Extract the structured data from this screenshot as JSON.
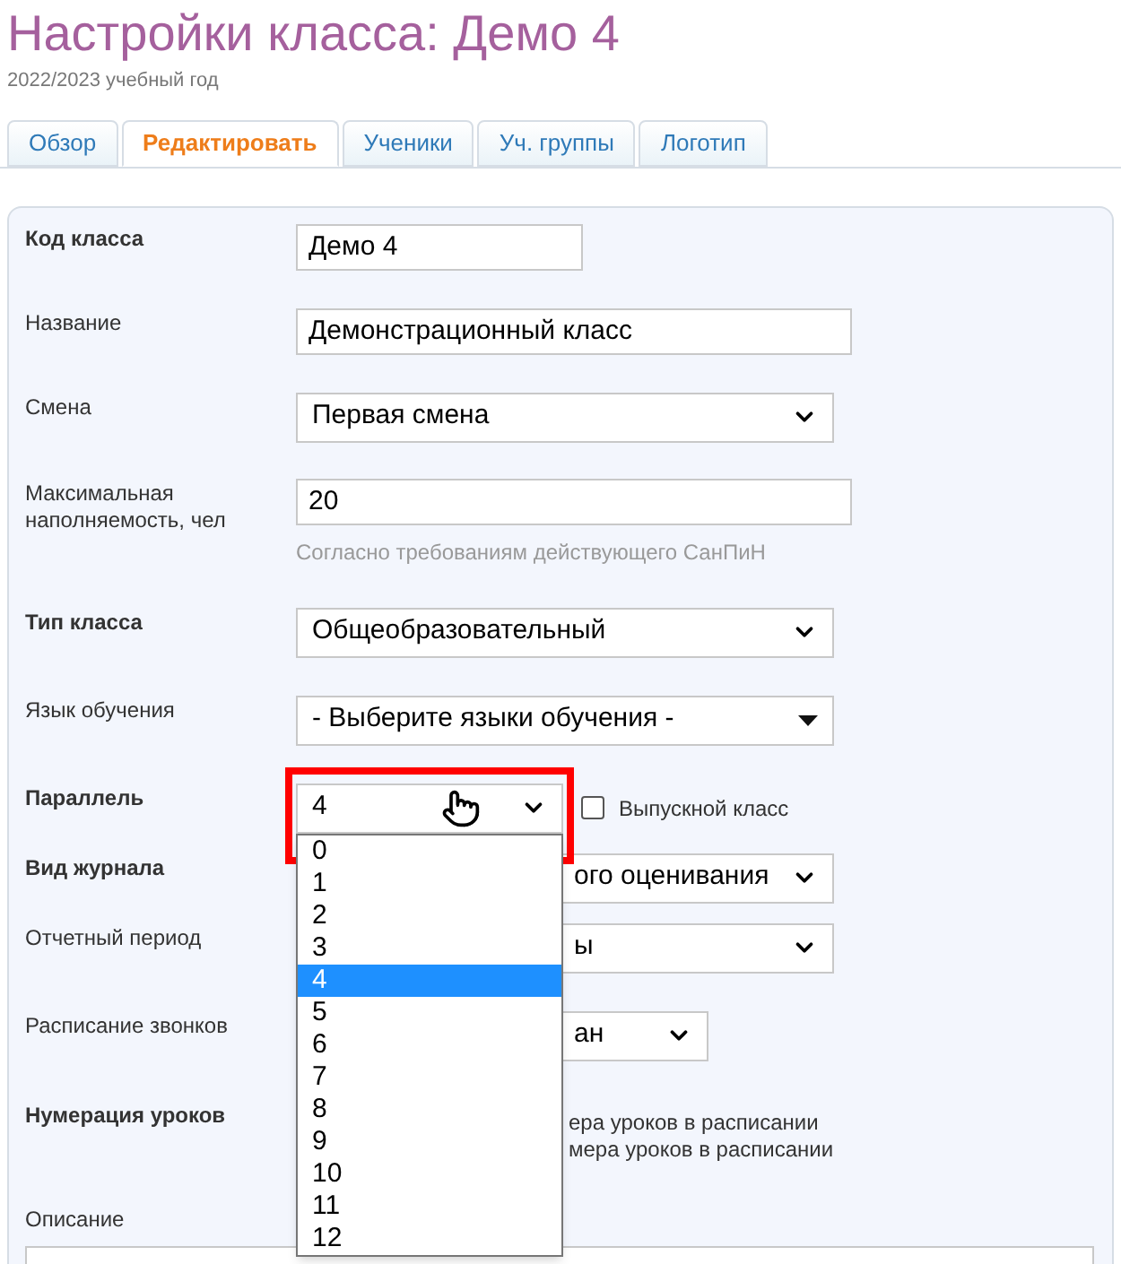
{
  "page": {
    "title": "Настройки класса: Демо 4",
    "subtitle": "2022/2023 учебный год"
  },
  "tabs": [
    {
      "label": "Обзор",
      "selected": false
    },
    {
      "label": "Редактировать",
      "selected": true
    },
    {
      "label": "Ученики",
      "selected": false
    },
    {
      "label": "Уч. группы",
      "selected": false
    },
    {
      "label": "Логотип",
      "selected": false
    }
  ],
  "form": [
    {
      "label": "Код класса",
      "bold": true,
      "kind": "text",
      "value": "Демо 4"
    },
    {
      "label": "Название",
      "bold": false,
      "kind": "text",
      "value": "Демонстрационный класс"
    },
    {
      "label": "Смена",
      "bold": false,
      "kind": "select",
      "value": "Первая смена"
    },
    {
      "label": "Максимальная наполняемость, чел",
      "bold": false,
      "kind": "text",
      "value": "20",
      "hint": "Согласно требованиям действующего СанПиН"
    },
    {
      "label": "Тип класса",
      "bold": true,
      "kind": "select",
      "value": "Общеобразовательный"
    },
    {
      "label": "Язык обучения",
      "bold": false,
      "kind": "multiselect",
      "value": "- Выберите языки обучения -"
    },
    {
      "label": "Параллель",
      "bold": true,
      "kind": "dropdown",
      "value": "4",
      "open": true,
      "highlighted": true,
      "checkbox": {
        "label": "Выпускной класс",
        "checked": false
      },
      "options": [
        {
          "label": "0",
          "selected": false
        },
        {
          "label": "1",
          "selected": false
        },
        {
          "label": "2",
          "selected": false
        },
        {
          "label": "3",
          "selected": false
        },
        {
          "label": "4",
          "selected": true
        },
        {
          "label": "5",
          "selected": false
        },
        {
          "label": "6",
          "selected": false
        },
        {
          "label": "7",
          "selected": false
        },
        {
          "label": "8",
          "selected": false
        },
        {
          "label": "9",
          "selected": false
        },
        {
          "label": "10",
          "selected": false
        },
        {
          "label": "11",
          "selected": false
        },
        {
          "label": "12",
          "selected": false
        }
      ]
    },
    {
      "label": "Вид журнала",
      "bold": true,
      "kind": "select",
      "value": "ого оценивания"
    },
    {
      "label": "Отчетный период",
      "bold": false,
      "kind": "select",
      "value": "ы"
    },
    {
      "label": "Расписание звонков",
      "bold": false,
      "kind": "select",
      "value": "ан"
    },
    {
      "label": "Нумерация уроков",
      "bold": true,
      "kind": "lines",
      "lines": [
        "ера уроков в расписании",
        "мера уроков в расписании"
      ]
    },
    {
      "label": "Описание",
      "bold": false,
      "kind": "textarea"
    }
  ]
}
